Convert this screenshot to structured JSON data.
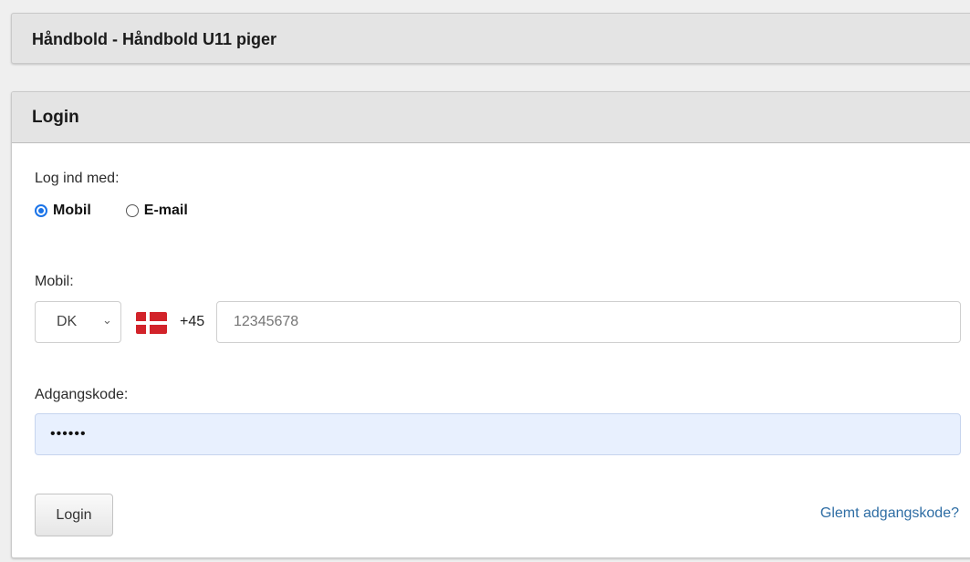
{
  "header": {
    "title": "Håndbold - Håndbold U11 piger"
  },
  "login_panel": {
    "heading": "Login",
    "login_with_label": "Log ind med:",
    "radio_options": [
      {
        "label": "Mobil",
        "checked": true
      },
      {
        "label": "E-mail",
        "checked": false
      }
    ],
    "mobile_label": "Mobil:",
    "country_select": {
      "value": "DK",
      "flag_icon": "denmark-flag-icon"
    },
    "dial_code": "+45",
    "phone_input": {
      "value": "",
      "placeholder": "12345678"
    },
    "password_label": "Adgangskode:",
    "password_input": {
      "value": "••••••"
    },
    "login_button_label": "Login",
    "forgot_password_link": "Glemt adgangskode?"
  },
  "colors": {
    "radio_accent": "#1a73e8",
    "link": "#2e6da4",
    "autofill_background": "#e8f0fe",
    "panel_heading": "#e4e4e4"
  }
}
